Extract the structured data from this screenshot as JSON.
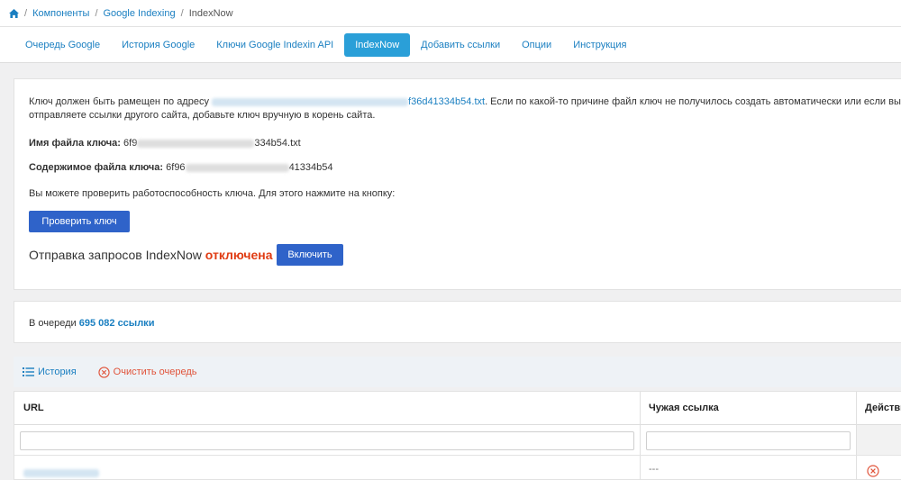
{
  "breadcrumb": {
    "items": [
      "Компоненты",
      "Google Indexing",
      "IndexNow"
    ],
    "separator": "/"
  },
  "tabs": [
    {
      "label": "Очередь Google",
      "active": false
    },
    {
      "label": "История Google",
      "active": false
    },
    {
      "label": "Ключи Google Indexin API",
      "active": false
    },
    {
      "label": "IndexNow",
      "active": true
    },
    {
      "label": "Добавить ссылки",
      "active": false
    },
    {
      "label": "Опции",
      "active": false
    },
    {
      "label": "Инструкция",
      "active": false
    }
  ],
  "key_card": {
    "intro_before": "Ключ должен быть рамещен по адресу",
    "intro_link_tail": "f36d41334b54.txt",
    "intro_after": ". Если по какой-то причине файл ключ не получилось создать автоматически или если вы",
    "intro_line2": "отправляете ссылки другого сайта, добавьте ключ вручную в корень сайта.",
    "filename_label": "Имя файла ключа:",
    "filename_head": "6f9",
    "filename_tail": "334b54.txt",
    "content_label": "Содержимое файла ключа:",
    "content_head": "6f96",
    "content_tail": "41334b54",
    "check_hint": "Вы можете проверить работоспособность ключа. Для этого нажмите на кнопку:",
    "check_button": "Проверить ключ",
    "status_prefix": "Отправка запросов IndexNow",
    "status_value": "отключена",
    "enable_button": "Включить"
  },
  "queue": {
    "prefix": "В очереди",
    "count": "695 082 ссылки"
  },
  "toolbar": {
    "history": "История",
    "clear": "Очистить очередь"
  },
  "table": {
    "columns": [
      "URL",
      "Чужая ссылка",
      "Действи"
    ],
    "rows": [
      {
        "foreign": "---"
      }
    ]
  },
  "colors": {
    "link": "#1a7fc1",
    "primary_button": "#2f63c9",
    "active_tab": "#2a9fd8",
    "status_off": "#e03b12"
  },
  "icons": {
    "home": "home-icon",
    "history": "list-icon",
    "clear": "circle-x-icon",
    "row_action": "circle-x-icon"
  }
}
